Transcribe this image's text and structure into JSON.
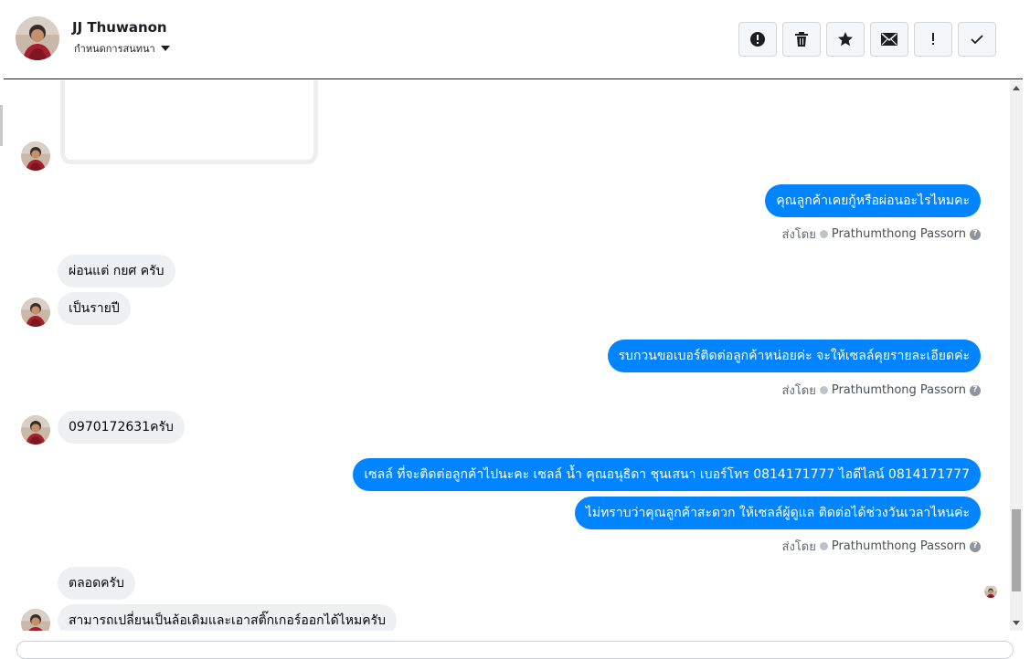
{
  "header": {
    "contact_name": "JJ Thuwanon",
    "assign_label": "กำหนดการสนทนา",
    "actions": [
      {
        "icon": "alert-circle-icon"
      },
      {
        "icon": "trash-icon"
      },
      {
        "icon": "star-icon"
      },
      {
        "icon": "envelope-icon"
      },
      {
        "icon": "exclamation-icon"
      },
      {
        "icon": "checkmark-icon"
      }
    ]
  },
  "messages": {
    "m1_out": "คุณลูกค้าเคยกู้หรือผ่อนอะไรไหมคะ",
    "m2_in": "ผ่อนแต่ กยศ ครับ",
    "m3_in": "เป็นรายปี",
    "m4_out": "รบกวนขอเบอร์ติดต่อลูกค้าหน่อยค่ะ จะให้เซลล์คุยรายละเอียดค่ะ",
    "m5_in": "0970172631ครับ",
    "m6_out": "เซลล์ ที่จะติดต่อลูกค้าไปนะคะ เซลล์ น้ำ คุณอนุธิดา ชุนเสนา เบอร์โทร 0814171777 ไอดีไลน์ 0814171777",
    "m7_out": "ไม่ทราบว่าคุณลูกค้าสะดวก ให้เซลล์ผู้ดูแล ติดต่อได้ช่วงวันเวลาไหนค่ะ",
    "m8_in": "ตลอดครับ",
    "m9_in": "สามารถเปลี่ยนเป็นล้อเดิมและเอาสติ๊กเกอร์ออกได้ไหมครับ"
  },
  "sent_by": {
    "prefix": "ส่งโดย",
    "agent": "Prathumthong Passorn"
  },
  "colors": {
    "outgoing_bubble": "#0084ff",
    "incoming_bubble": "#eff0f1"
  }
}
